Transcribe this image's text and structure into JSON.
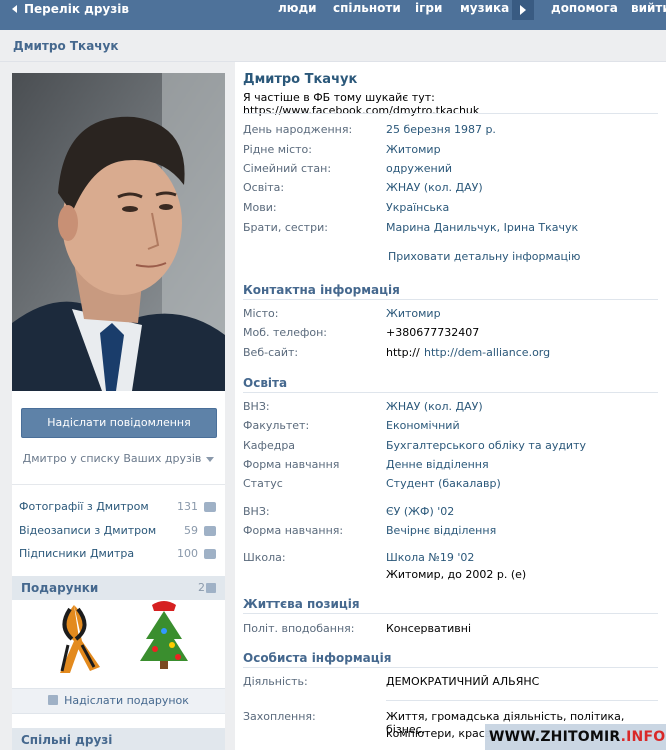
{
  "topbar": {
    "back_label": "Перелік друзів",
    "nav": [
      "люди",
      "спільноти",
      "ігри",
      "музика",
      "допомога",
      "вийти"
    ]
  },
  "page_title": "Дмитро Ткачук",
  "left": {
    "send_message": "Надіслати повідомлення",
    "friend_status": "Дмитро у списку Ваших друзів",
    "links": [
      {
        "label": "Фотографії з Дмитром",
        "count": "131",
        "icon": "camera-icon"
      },
      {
        "label": "Відеозаписи з Дмитром",
        "count": "59",
        "icon": "film-icon"
      },
      {
        "label": "Підписники Дмитра",
        "count": "100",
        "icon": "people-icon"
      }
    ],
    "gifts_header": "Подарунки",
    "gifts_count": "2",
    "send_gift": "Надіслати подарунок",
    "common_friends": "Спільні друзі"
  },
  "profile": {
    "name": "Дмитро Ткачук",
    "status": "Я частіше в ФБ тому шукайє тут: https://www.facebook.com/dmytro.tkachuk",
    "basic": [
      {
        "label": "День народження:",
        "value": "25 березня 1987 р."
      },
      {
        "label": "Рідне місто:",
        "value": "Житомир"
      },
      {
        "label": "Сімейний стан:",
        "value": "одружений"
      },
      {
        "label": "Освіта:",
        "value": "ЖНАУ (кол. ДАУ)"
      },
      {
        "label": "Мови:",
        "value": "Українська"
      },
      {
        "label": "Брати, сестри:",
        "value": "Марина Данильчук, Ірина Ткачук"
      }
    ],
    "hide_details": "Приховати детальну інформацію",
    "contact_header": "Контактна інформація",
    "contact": [
      {
        "label": "Місто:",
        "value": "Житомир"
      },
      {
        "label": "Моб. телефон:",
        "value": "+380677732407"
      },
      {
        "label": "Веб-сайт:",
        "value_prefix": "http://",
        "value": "http://dem-alliance.org"
      }
    ],
    "education_header": "Освіта",
    "education": [
      {
        "label": "ВНЗ:",
        "value": "ЖНАУ (кол. ДАУ)"
      },
      {
        "label": "Факультет:",
        "value": "Економічний"
      },
      {
        "label": "Кафедра",
        "value": "Бухгалтерського обліку та аудиту"
      },
      {
        "label": "Форма навчання",
        "value": "Денне відділення"
      },
      {
        "label": "Статус",
        "value": "Студент (бакалавр)"
      },
      {
        "label": "ВНЗ:",
        "value": "ЄУ (ЖФ) '02"
      },
      {
        "label": "Форма навчання:",
        "value": "Вечірнє відділення"
      },
      {
        "label": "Школа:",
        "value": "Школа №19 '02",
        "value2": "Житомир, до 2002 р. (е)"
      }
    ],
    "life_header": "Життєва позиція",
    "life": [
      {
        "label": "Політ. вподобання:",
        "value": "Консервативні"
      }
    ],
    "personal_header": "Особиста інформація",
    "personal": [
      {
        "label": "Діяльність:",
        "value": "ДЕМОКРАТИЧНИЙ АЛЬЯНС"
      },
      {
        "label": "Захоплення:",
        "value": "Життя, громадська діяльність, політика, бізнес,",
        "value2": "компютери, краса у вс"
      }
    ]
  },
  "watermark": {
    "part1": "WWW.",
    "part2": "ZHITOMIR",
    "part3": ".INFO"
  }
}
